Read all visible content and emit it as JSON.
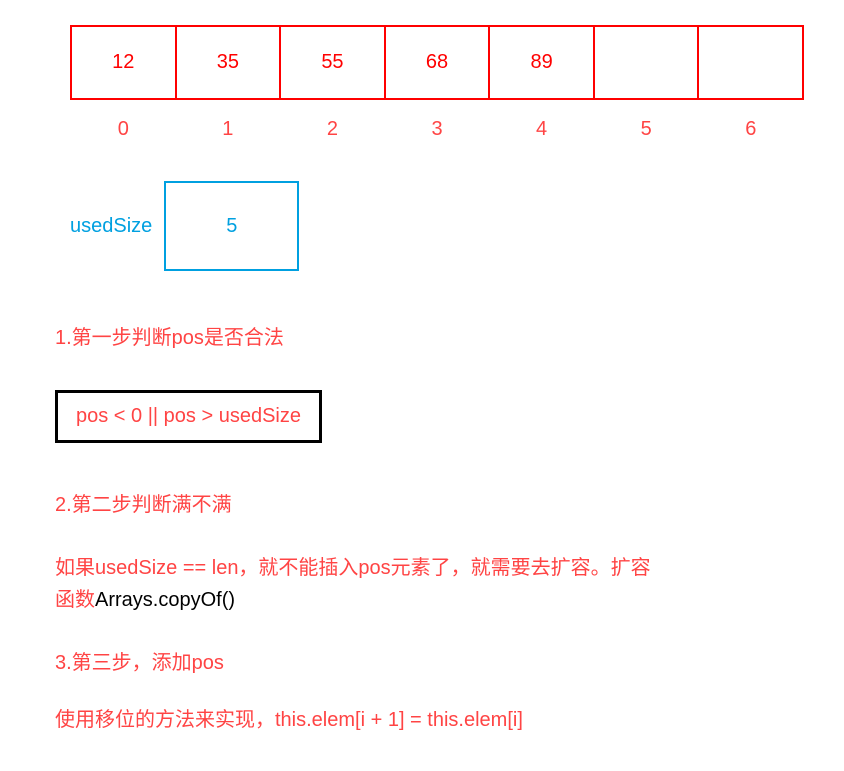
{
  "array": {
    "cells": [
      "12",
      "35",
      "55",
      "68",
      "89",
      "",
      ""
    ],
    "indices": [
      "0",
      "1",
      "2",
      "3",
      "4",
      "5",
      "6"
    ]
  },
  "usedSize": {
    "label": "usedSize",
    "value": "5"
  },
  "steps": {
    "step1": "1.第一步判断pos是否合法",
    "condition": "pos < 0 || pos > usedSize",
    "step2": "2.第二步判断满不满",
    "description_red1": "如果usedSize == len，就不能插入pos元素了，就需要去扩容。扩容函数",
    "description_black1": "Arrays.copyOf()",
    "step3": "3.第三步，添加pos",
    "step4": "使用移位的方法来实现，this.elem[i + 1] = this.elem[i]"
  }
}
